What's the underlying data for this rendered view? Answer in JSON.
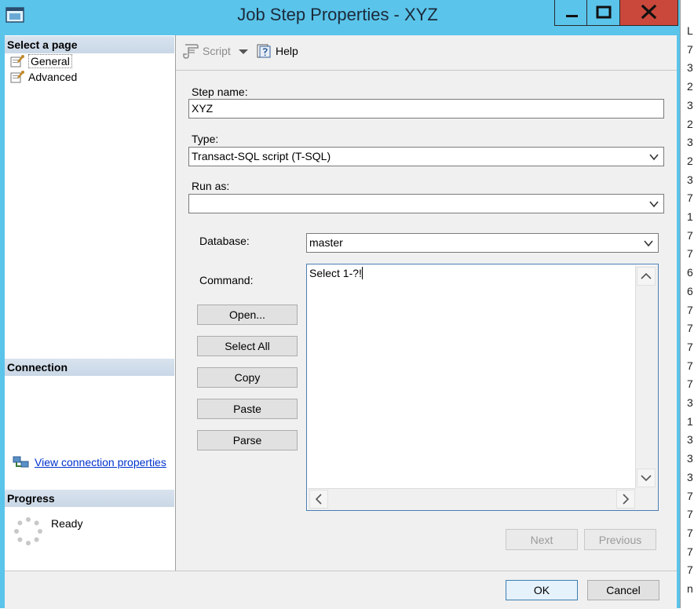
{
  "window": {
    "title": "Job Step Properties - XYZ",
    "accent_color": "#5bc4ea",
    "close_color": "#c9483b"
  },
  "left_pane": {
    "select_page_header": "Select a page",
    "pages": [
      {
        "label": "General",
        "icon": "page-wrench-icon"
      },
      {
        "label": "Advanced",
        "icon": "page-wrench-icon"
      }
    ],
    "connection_header": "Connection",
    "view_connection_link": "View connection properties",
    "progress_header": "Progress",
    "progress_status": "Ready"
  },
  "toolbar": {
    "script_label": "Script",
    "help_label": "Help"
  },
  "form": {
    "step_name_label": "Step name:",
    "step_name_value": "XYZ",
    "type_label": "Type:",
    "type_value": "Transact-SQL script (T-SQL)",
    "run_as_label": "Run as:",
    "run_as_value": "",
    "database_label": "Database:",
    "database_value": "master",
    "command_label": "Command:",
    "command_value": "Select 1-?!"
  },
  "command_buttons": {
    "open": "Open...",
    "select_all": "Select All",
    "copy": "Copy",
    "paste": "Paste",
    "parse": "Parse"
  },
  "nav_buttons": {
    "next": "Next",
    "previous": "Previous"
  },
  "dialog_buttons": {
    "ok": "OK",
    "cancel": "Cancel"
  },
  "background_window": {
    "chars": [
      "L",
      "7",
      "3",
      "2",
      "3",
      "2",
      "3",
      "2",
      "3",
      "7",
      "1",
      "7",
      "7",
      "6",
      "6",
      "7",
      "7",
      "7",
      "7",
      "7",
      "3",
      "1",
      "3",
      "3",
      "3",
      "7",
      "7",
      "7",
      "7",
      "7",
      "n"
    ]
  }
}
